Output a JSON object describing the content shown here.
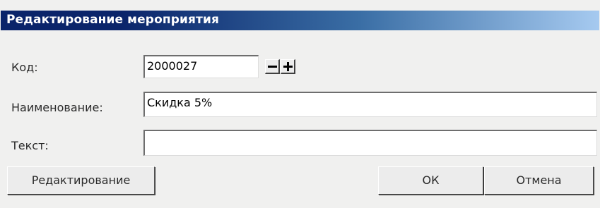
{
  "window": {
    "title": "Редактирование мероприятия"
  },
  "form": {
    "code": {
      "label": "Код:",
      "value": "2000027"
    },
    "name": {
      "label": "Наименование:",
      "value": "Скидка 5%"
    },
    "text": {
      "label": "Текст:",
      "value": ""
    }
  },
  "buttons": {
    "edit": "Редактирование",
    "ok": "ОК",
    "cancel": "Отмена"
  },
  "icons": {
    "decrement": "minus-icon",
    "increment": "plus-icon"
  }
}
